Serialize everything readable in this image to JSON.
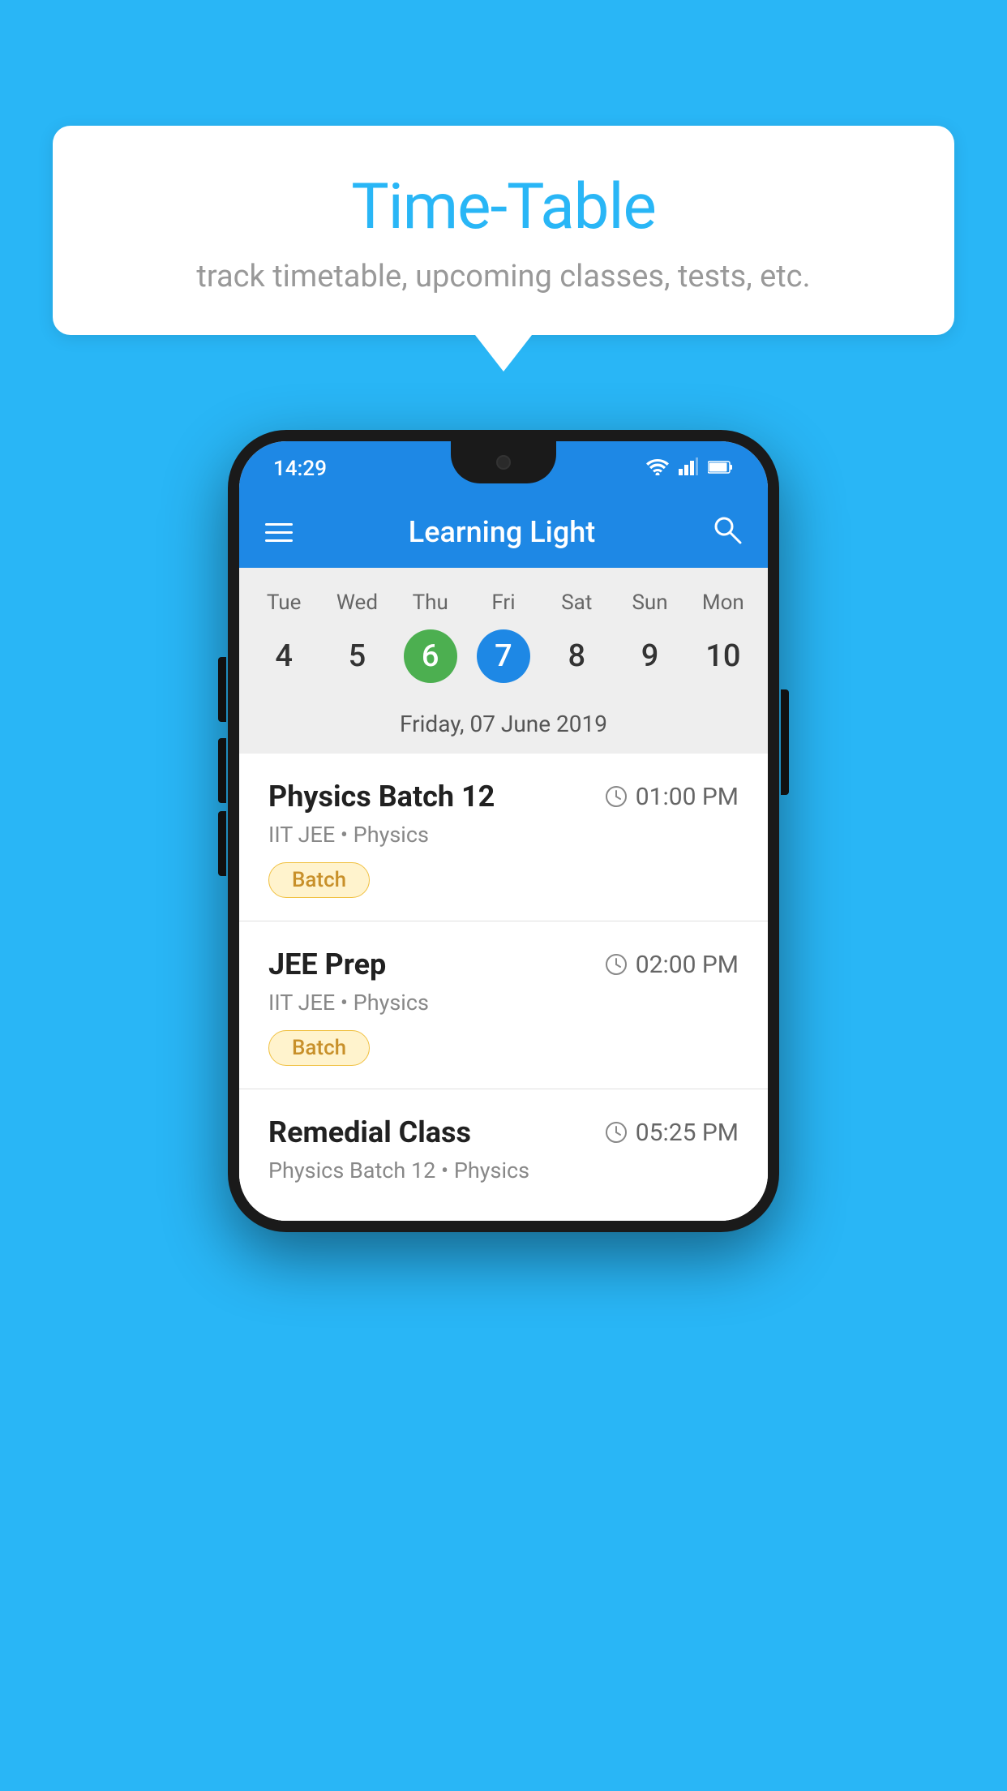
{
  "background_color": "#29B6F6",
  "speech_bubble": {
    "title": "Time-Table",
    "subtitle": "track timetable, upcoming classes, tests, etc."
  },
  "status_bar": {
    "time": "14:29",
    "wifi": "wifi",
    "signal": "signal",
    "battery": "battery"
  },
  "app_bar": {
    "title": "Learning Light",
    "menu_icon": "hamburger",
    "search_icon": "search"
  },
  "calendar": {
    "days": [
      "Tue",
      "Wed",
      "Thu",
      "Fri",
      "Sat",
      "Sun",
      "Mon"
    ],
    "dates": [
      {
        "num": "4",
        "state": "normal"
      },
      {
        "num": "5",
        "state": "normal"
      },
      {
        "num": "6",
        "state": "today"
      },
      {
        "num": "7",
        "state": "selected"
      },
      {
        "num": "8",
        "state": "normal"
      },
      {
        "num": "9",
        "state": "normal"
      },
      {
        "num": "10",
        "state": "normal"
      }
    ],
    "selected_label": "Friday, 07 June 2019"
  },
  "schedule_items": [
    {
      "title": "Physics Batch 12",
      "time": "01:00 PM",
      "subtitle": "IIT JEE • Physics",
      "badge": "Batch"
    },
    {
      "title": "JEE Prep",
      "time": "02:00 PM",
      "subtitle": "IIT JEE • Physics",
      "badge": "Batch"
    },
    {
      "title": "Remedial Class",
      "time": "05:25 PM",
      "subtitle": "Physics Batch 12 • Physics",
      "badge": null
    }
  ]
}
